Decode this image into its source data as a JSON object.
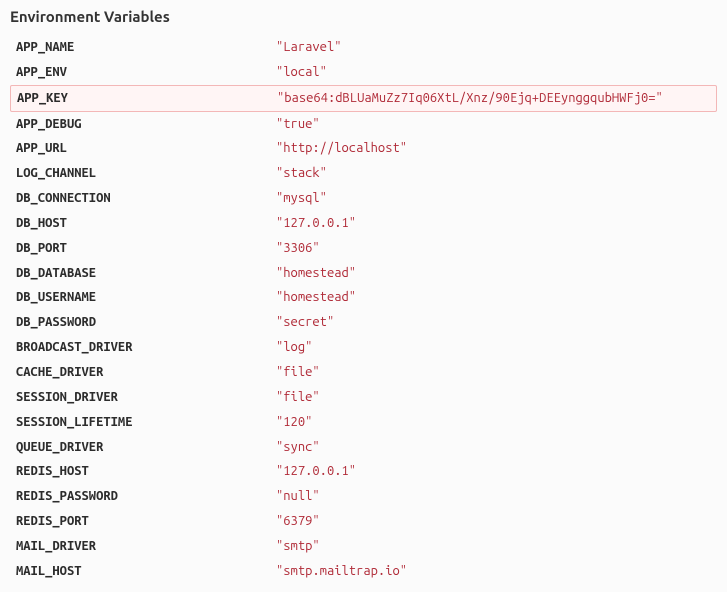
{
  "heading": "Environment Variables",
  "env": [
    {
      "key": "APP_NAME",
      "value": "\"Laravel\"",
      "highlighted": false
    },
    {
      "key": "APP_ENV",
      "value": "\"local\"",
      "highlighted": false
    },
    {
      "key": "APP_KEY",
      "value": "\"base64:dBLUaMuZz7Iq06XtL/Xnz/90Ejq+DEEynggqubHWFj0=\"",
      "highlighted": true
    },
    {
      "key": "APP_DEBUG",
      "value": "\"true\"",
      "highlighted": false
    },
    {
      "key": "APP_URL",
      "value": "\"http://localhost\"",
      "highlighted": false
    },
    {
      "key": "LOG_CHANNEL",
      "value": "\"stack\"",
      "highlighted": false
    },
    {
      "key": "DB_CONNECTION",
      "value": "\"mysql\"",
      "highlighted": false
    },
    {
      "key": "DB_HOST",
      "value": "\"127.0.0.1\"",
      "highlighted": false
    },
    {
      "key": "DB_PORT",
      "value": "\"3306\"",
      "highlighted": false
    },
    {
      "key": "DB_DATABASE",
      "value": "\"homestead\"",
      "highlighted": false
    },
    {
      "key": "DB_USERNAME",
      "value": "\"homestead\"",
      "highlighted": false
    },
    {
      "key": "DB_PASSWORD",
      "value": "\"secret\"",
      "highlighted": false
    },
    {
      "key": "BROADCAST_DRIVER",
      "value": "\"log\"",
      "highlighted": false
    },
    {
      "key": "CACHE_DRIVER",
      "value": "\"file\"",
      "highlighted": false
    },
    {
      "key": "SESSION_DRIVER",
      "value": "\"file\"",
      "highlighted": false
    },
    {
      "key": "SESSION_LIFETIME",
      "value": "\"120\"",
      "highlighted": false
    },
    {
      "key": "QUEUE_DRIVER",
      "value": "\"sync\"",
      "highlighted": false
    },
    {
      "key": "REDIS_HOST",
      "value": "\"127.0.0.1\"",
      "highlighted": false
    },
    {
      "key": "REDIS_PASSWORD",
      "value": "\"null\"",
      "highlighted": false
    },
    {
      "key": "REDIS_PORT",
      "value": "\"6379\"",
      "highlighted": false
    },
    {
      "key": "MAIL_DRIVER",
      "value": "\"smtp\"",
      "highlighted": false
    },
    {
      "key": "MAIL_HOST",
      "value": "\"smtp.mailtrap.io\"",
      "highlighted": false
    }
  ]
}
